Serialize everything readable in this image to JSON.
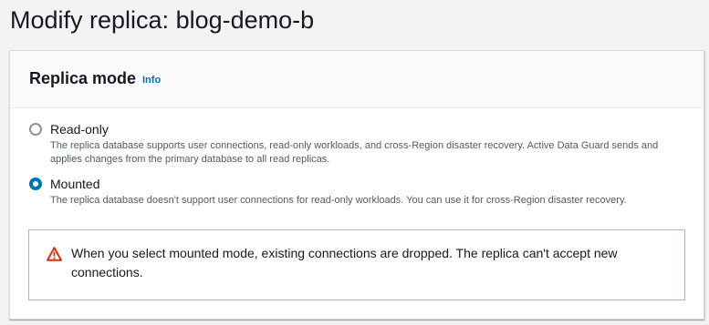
{
  "page": {
    "title": "Modify replica: blog-demo-b"
  },
  "replica_mode": {
    "heading": "Replica mode",
    "info_label": "Info",
    "options": [
      {
        "label": "Read-only",
        "description": "The replica database supports user connections, read-only workloads, and cross-Region disaster recovery. Active Data Guard sends and applies changes from the primary database to all read replicas.",
        "selected": false
      },
      {
        "label": "Mounted",
        "description": "The replica database doesn't support user connections for read-only workloads. You can use it for cross-Region disaster recovery.",
        "selected": true
      }
    ],
    "warning": {
      "icon": "warning-triangle-icon",
      "text": "When you select mounted mode, existing connections are dropped. The replica can't accept new connections."
    }
  },
  "colors": {
    "accent": "#0073bb",
    "warning": "#d13212",
    "page_background": "#f2f3f3"
  }
}
